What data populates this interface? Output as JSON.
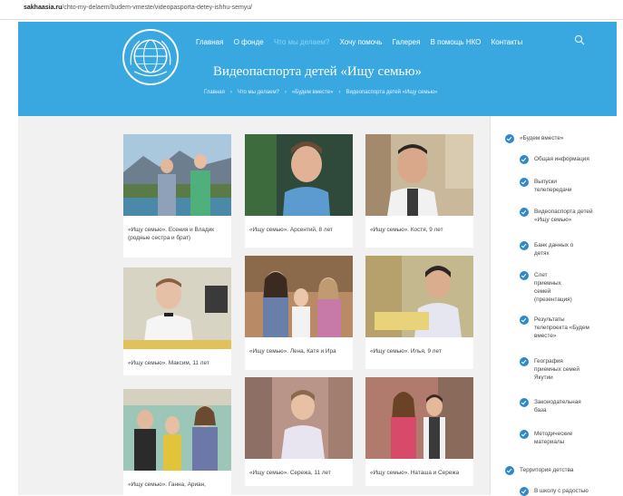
{
  "browser": {
    "url_domain": "sakhaasia.ru",
    "url_path": "/chto-my-delaem/budem-vmeste/videopasporta-detey-ishhu-semyu/"
  },
  "header": {
    "nav": [
      "Главная",
      "О фонде",
      "Что мы делаем?",
      "Хочу помочь",
      "Галерея",
      "В помощь НКО",
      "Контакты"
    ],
    "active_nav_index": 2,
    "title": "Видеопаспорта детей «Ищу семью»",
    "breadcrumb": [
      "Главная",
      "Что мы делаем?",
      "«Будем вместе»",
      "Видеопаспорта детей «Ищу семью»"
    ],
    "accent_color": "#3aa8e0"
  },
  "cards": [
    {
      "caption": "«Ищу семью». Есения и Владик (родные сестра и брат)"
    },
    {
      "caption": "«Ищу семью». Арсентий, 8 лет"
    },
    {
      "caption": "«Ищу семью». Костя, 9 лет"
    },
    {
      "caption": "«Ищу семью». Максим, 11 лет"
    },
    {
      "caption": "«Ищу семью». Лена, Катя и Ира"
    },
    {
      "caption": "«Ищу семью». Илья, 9 лет"
    },
    {
      "caption": "«Ищу семью». Ганна, Ариан,"
    },
    {
      "caption": "«Ищу семью». Сережа, 11 лет"
    },
    {
      "caption": "«Ищу семью». Наташа и Сережа"
    }
  ],
  "sidebar": {
    "items": [
      {
        "label": "«Будем вместе»",
        "level": 0
      },
      {
        "label": "Общая информация",
        "level": 1
      },
      {
        "label": "Выпуски телепередачи",
        "level": 1
      },
      {
        "label": "Видеопаспорта детей «Ищу семью»",
        "level": 1
      },
      {
        "label": "Банк данных о детях",
        "level": 1
      },
      {
        "label": "Слет приемных семей (презентация)",
        "level": 1
      },
      {
        "label": "Результаты телепроекта «Будем вместе»",
        "level": 1
      },
      {
        "label": "География приемных семей Якутии",
        "level": 1
      },
      {
        "label": "Законодательная база",
        "level": 1
      },
      {
        "label": "Методические материалы",
        "level": 1
      },
      {
        "label": "Территория детства",
        "level": 0
      },
      {
        "label": "В школу с радостью",
        "level": 1
      }
    ]
  }
}
